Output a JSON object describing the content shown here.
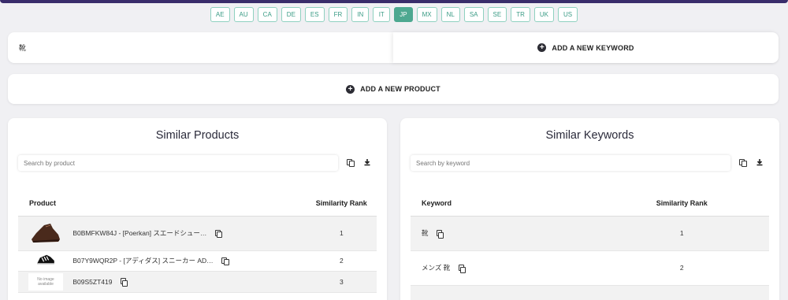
{
  "countries": [
    "AE",
    "AU",
    "CA",
    "DE",
    "ES",
    "FR",
    "IN",
    "IT",
    "JP",
    "MX",
    "NL",
    "SA",
    "SE",
    "TR",
    "UK",
    "US"
  ],
  "active_country": "JP",
  "keyword_bar": {
    "current_keyword": "靴",
    "add_keyword_label": "ADD A NEW KEYWORD"
  },
  "add_product_label": "ADD A NEW PRODUCT",
  "similar_products": {
    "title": "Similar Products",
    "search_placeholder": "Search by product",
    "columns": {
      "product": "Product",
      "rank": "Similarity Rank"
    },
    "rows": [
      {
        "product": "B0BMFKW84J - [Poerkan] スエードシュー…",
        "rank": "1",
        "image": "brown-leather-shoe"
      },
      {
        "product": "B07Y9WQR2P - [アディダス] スニーカー AD…",
        "rank": "2",
        "image": "black-white-sneaker"
      },
      {
        "product": "B09S5ZT419",
        "rank": "3",
        "image": "no-image",
        "no_image_text": [
          "No image",
          "available"
        ]
      }
    ]
  },
  "similar_keywords": {
    "title": "Similar Keywords",
    "search_placeholder": "Search by keyword",
    "columns": {
      "keyword": "Keyword",
      "rank": "Similarity Rank"
    },
    "rows": [
      {
        "keyword": "靴",
        "rank": "1"
      },
      {
        "keyword": "メンズ 靴",
        "rank": "2"
      }
    ]
  },
  "icons": {
    "copy": "copy-icon",
    "download": "download-icon",
    "plus": "plus-circle-icon"
  },
  "colors": {
    "accent": "#4da890",
    "topbar": "#3a2d6b"
  }
}
